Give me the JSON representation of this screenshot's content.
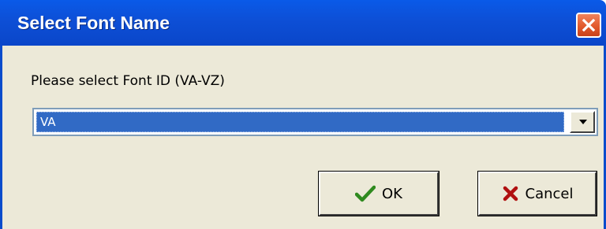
{
  "window": {
    "title": "Select Font Name",
    "close_icon": "close-icon"
  },
  "prompt": {
    "text": "Please select Font ID (VA-VZ)"
  },
  "font_select": {
    "selected_value": "VA",
    "dropdown_icon": "chevron-down-icon"
  },
  "buttons": {
    "ok_label": "OK",
    "ok_icon": "checkmark-icon",
    "cancel_label": "Cancel",
    "cancel_icon": "x-mark-icon"
  },
  "colors": {
    "titlebar": "#0a4ccc",
    "close_button": "#e25a2c",
    "selection": "#316ac5",
    "ok_check": "#2f8a1f",
    "cancel_x": "#b01010"
  }
}
